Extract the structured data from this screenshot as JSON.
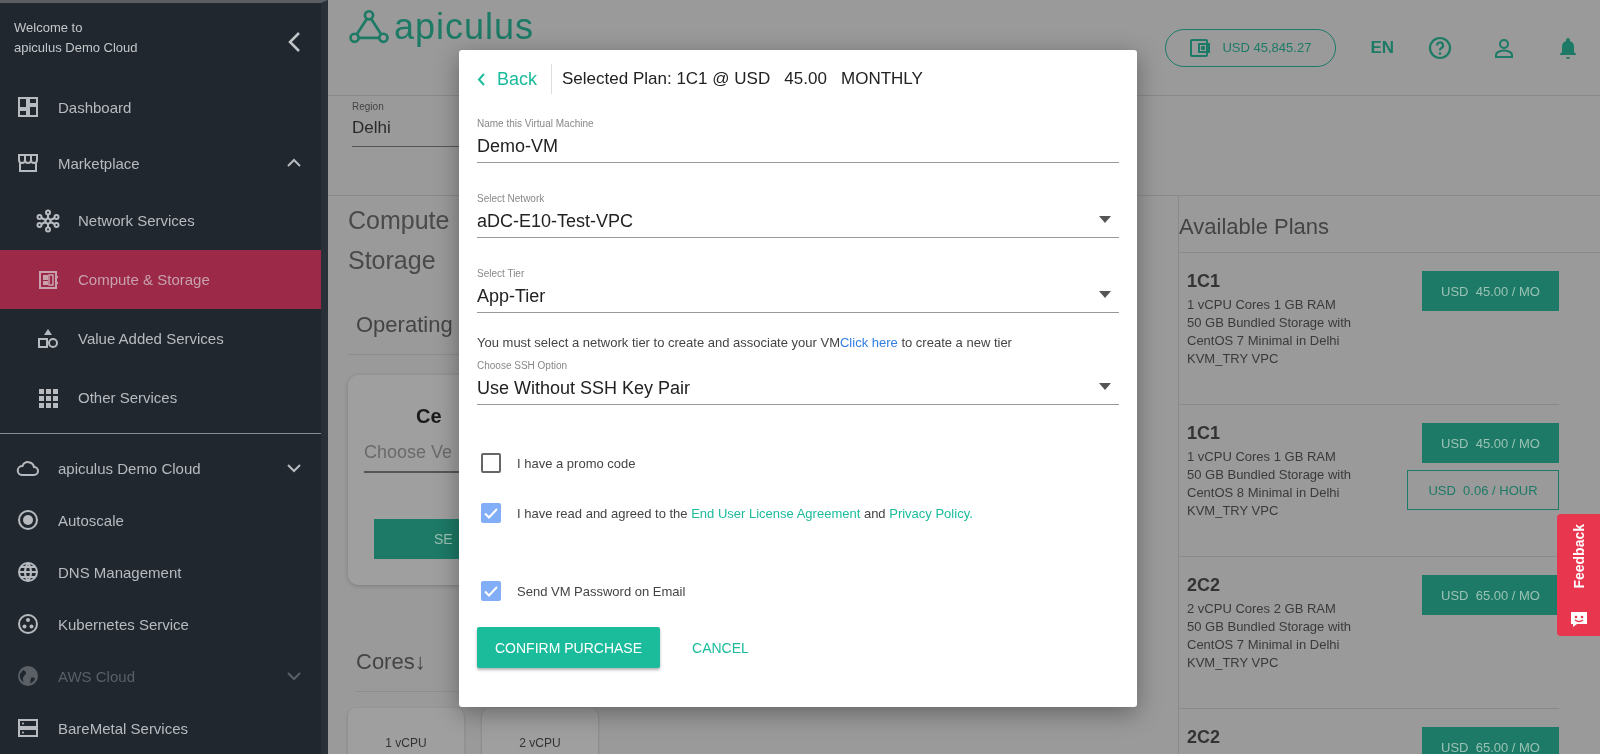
{
  "sidebar": {
    "welcome": "Welcome to\napiculus Demo Cloud",
    "items": [
      {
        "label": "Dashboard",
        "selected": false,
        "disabled": false
      },
      {
        "label": "Marketplace",
        "selected": false,
        "disabled": false,
        "expanded": true,
        "children": [
          {
            "label": "Network Services",
            "selected": false
          },
          {
            "label": "Compute & Storage",
            "selected": true
          },
          {
            "label": "Value Added Services",
            "selected": false
          },
          {
            "label": "Other Services",
            "selected": false
          }
        ]
      },
      {
        "label": "apiculus Demo Cloud",
        "selected": false,
        "disabled": false,
        "expanded": false
      },
      {
        "label": "Autoscale",
        "selected": false,
        "disabled": false
      },
      {
        "label": "DNS Management",
        "selected": false,
        "disabled": false
      },
      {
        "label": "Kubernetes Service",
        "selected": false,
        "disabled": false
      },
      {
        "label": "AWS Cloud",
        "selected": false,
        "disabled": true,
        "expanded": false
      },
      {
        "label": "BareMetal Services",
        "selected": false,
        "disabled": false
      }
    ]
  },
  "header": {
    "logo": "apiculus",
    "balance": "USD 45,845.27",
    "language": "EN"
  },
  "region": {
    "label": "Region",
    "value": "Delhi"
  },
  "content": {
    "heading": [
      "Compute",
      "Storage"
    ],
    "section": "Operating",
    "card": {
      "title": "Ce",
      "placeholder": "Choose Ve",
      "button": "SE"
    },
    "sort": "Cores↓",
    "cores": [
      "1 vCPU",
      "2 vCPU"
    ]
  },
  "plans_panel": {
    "title": "Available Plans",
    "plans": [
      {
        "name": "1C1",
        "lines": [
          "1 vCPU Cores 1 GB RAM",
          "50 GB Bundled Storage with",
          "CentOS 7 Minimal in Delhi",
          "KVM_TRY VPC"
        ],
        "prices": [
          {
            "label": "USD  45.00 / MO",
            "kind": "monthly"
          }
        ]
      },
      {
        "name": "1C1",
        "lines": [
          "1 vCPU Cores 1 GB RAM",
          "50 GB Bundled Storage with",
          "CentOS 8 Minimal in Delhi",
          "KVM_TRY VPC"
        ],
        "prices": [
          {
            "label": "USD  45.00 / MO",
            "kind": "monthly"
          },
          {
            "label": "USD  0.06 / HOUR",
            "kind": "hourly"
          }
        ]
      },
      {
        "name": "2C2",
        "lines": [
          "2 vCPU Cores 2 GB RAM",
          "50 GB Bundled Storage with",
          "CentOS 7 Minimal in Delhi",
          "KVM_TRY VPC"
        ],
        "prices": [
          {
            "label": "USD  65.00 / MO",
            "kind": "monthly"
          }
        ]
      },
      {
        "name": "2C2",
        "prices": [
          {
            "label": "USD  65.00 / MO",
            "kind": "monthly"
          }
        ]
      }
    ]
  },
  "feedback": "Feedback",
  "modal": {
    "back": "Back",
    "title": "Selected Plan: 1C1 @ USD   45.00   MONTHLY",
    "form": [
      {
        "kind": "text",
        "label": "Name this Virtual Machine",
        "value": "Demo-VM"
      },
      {
        "kind": "select",
        "label": "Select Network",
        "value": "aDC-E10-Test-VPC"
      },
      {
        "kind": "select",
        "label": "Select Tier",
        "value": "App-Tier"
      },
      {
        "kind": "note",
        "segments": [
          {
            "text": "You must select a network tier to create and associate your VM",
            "link": false
          },
          {
            "text": "Click here",
            "link": true
          },
          {
            "text": " to create a new tier",
            "link": false
          }
        ]
      },
      {
        "kind": "select",
        "label": "Choose SSH Option",
        "value": "Use Without SSH Key Pair"
      }
    ],
    "checkboxes": [
      {
        "checked": false,
        "segments": [
          {
            "text": "I have a promo code",
            "link": false
          }
        ]
      },
      {
        "checked": true,
        "segments": [
          {
            "text": "I have read and agreed to the ",
            "link": false
          },
          {
            "text": "End User License Agreement",
            "link": true
          },
          {
            "text": " and ",
            "link": false
          },
          {
            "text": "Privacy Policy.",
            "link": true
          }
        ]
      },
      {
        "checked": true,
        "segments": [
          {
            "text": "Send VM Password on Email",
            "link": false
          }
        ]
      }
    ],
    "buttons": [
      {
        "label": "CONFIRM PURCHASE",
        "kind": "primary"
      },
      {
        "label": "CANCEL",
        "kind": "text"
      }
    ]
  }
}
